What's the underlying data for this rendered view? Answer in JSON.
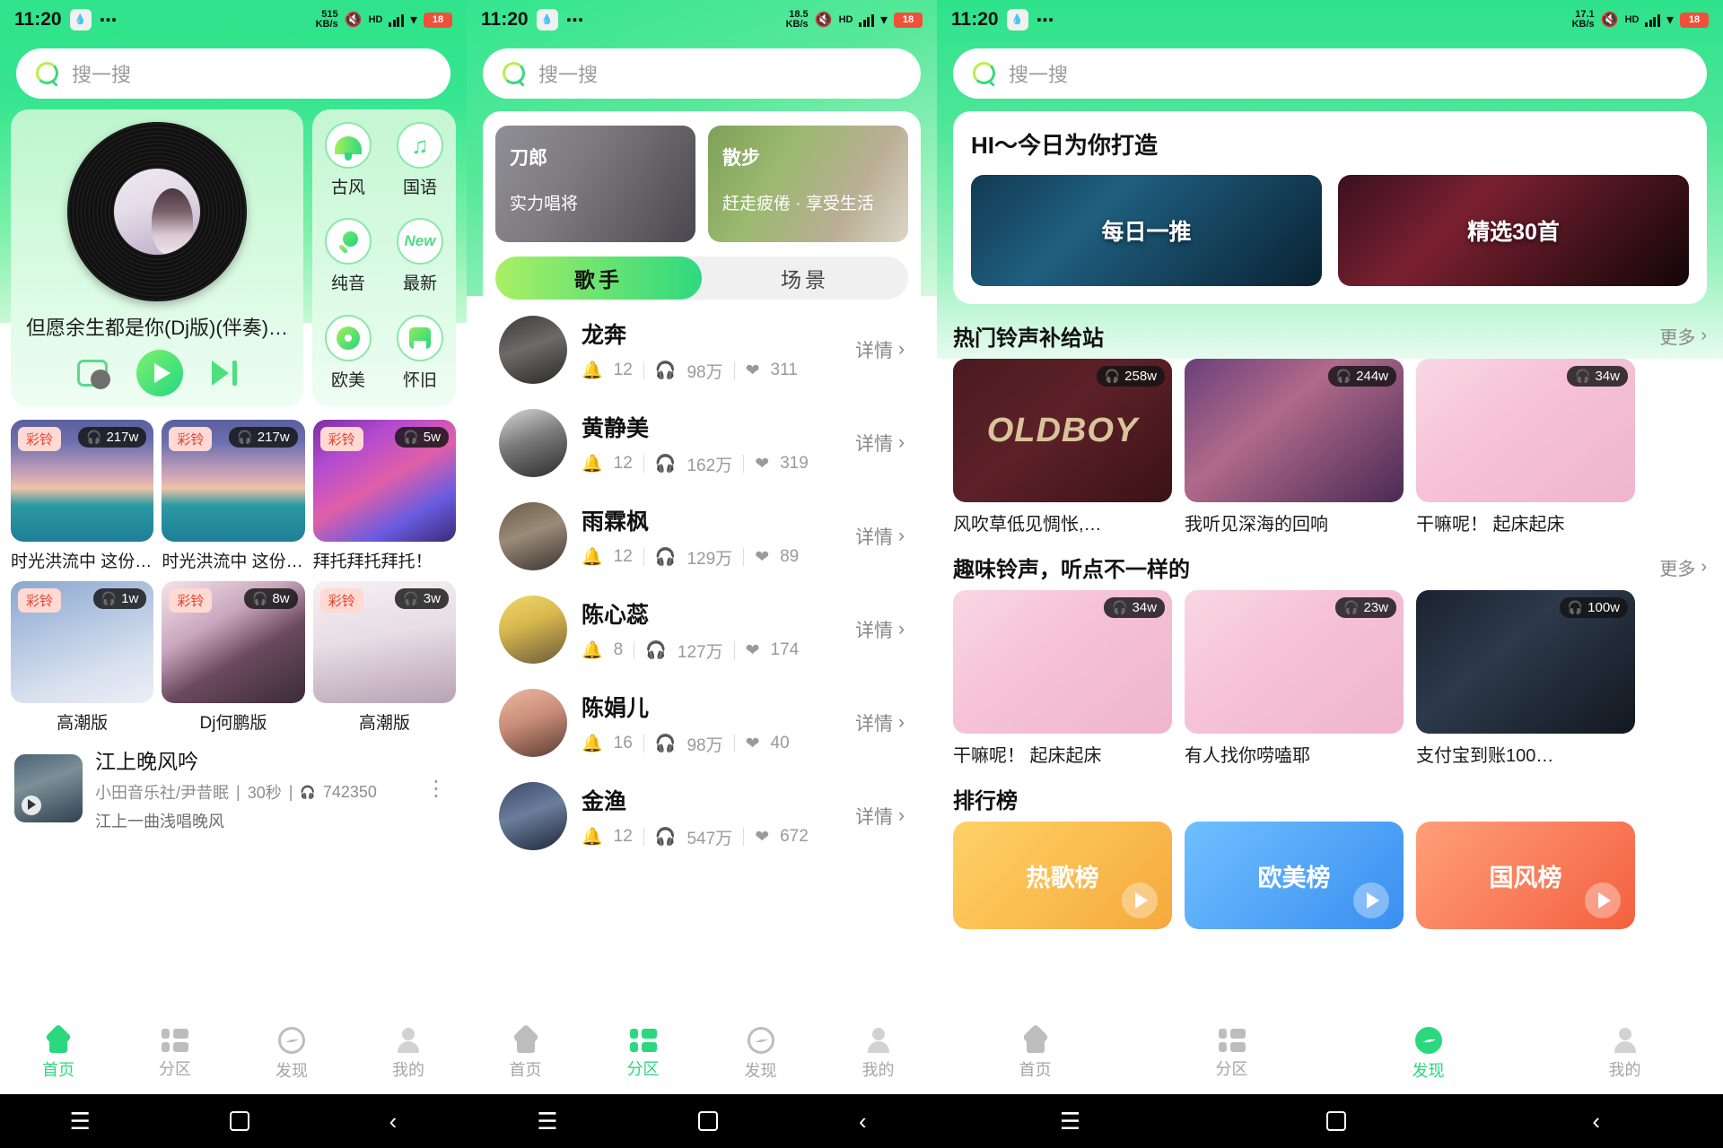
{
  "status_bar": {
    "time": "11:20",
    "badge_icon": "water-drop-icon",
    "dots": "⋯",
    "net_p1": "515\nKB/s",
    "net_p2": "18.5\nKB/s",
    "net_p3": "17.1\nKB/s",
    "hd": "HD",
    "battery": "18"
  },
  "search": {
    "placeholder": "搜一搜"
  },
  "panel1": {
    "player": {
      "song_title": "但愿余生都是你(Dj版)(伴奏)…",
      "record_label": "record-button",
      "play_label": "play-button",
      "next_label": "next-button"
    },
    "categories": [
      {
        "label": "古风",
        "icon": "fan-icon"
      },
      {
        "label": "国语",
        "icon": "music-note-icon"
      },
      {
        "label": "纯音",
        "icon": "microphone-icon"
      },
      {
        "label": "最新",
        "icon": "new-icon"
      },
      {
        "label": "欧美",
        "icon": "cd-icon"
      },
      {
        "label": "怀旧",
        "icon": "radio-icon"
      }
    ],
    "thumbs": [
      {
        "tag": "彩铃",
        "plays": "217w",
        "caption": "时光洪流中 这份…",
        "art": "art-wave",
        "center": false
      },
      {
        "tag": "彩铃",
        "plays": "217w",
        "caption": "时光洪流中 这份…",
        "art": "art-wave",
        "center": false
      },
      {
        "tag": "彩铃",
        "plays": "5w",
        "caption": "拜托拜托拜托！",
        "art": "art-anime",
        "center": false
      },
      {
        "tag": "彩铃",
        "plays": "1w",
        "caption": "高潮版",
        "art": "art-snow",
        "center": true
      },
      {
        "tag": "彩铃",
        "plays": "8w",
        "caption": "Dj何鹏版",
        "art": "art-girl",
        "center": true
      },
      {
        "tag": "彩铃",
        "plays": "3w",
        "caption": "高潮版",
        "art": "art-girl2",
        "center": true
      }
    ],
    "song": {
      "name": "江上晚风吟",
      "artist": "小田音乐社/尹昔眠",
      "duration": "30秒",
      "plays": "742350",
      "lyric": "江上一曲浅唱晚风",
      "more": "more-icon"
    },
    "tabs": [
      {
        "label": "首页",
        "icon": "home-icon",
        "active": true
      },
      {
        "label": "分区",
        "icon": "grid-icon",
        "active": false
      },
      {
        "label": "发现",
        "icon": "compass-icon",
        "active": false
      },
      {
        "label": "我的",
        "icon": "user-icon",
        "active": false
      }
    ]
  },
  "panel2": {
    "banners": [
      {
        "line1": "刀郎",
        "line2": "实力唱将",
        "theme": "bn-dl"
      },
      {
        "line1": "散步",
        "line2": "赶走疲倦 · 享受生活",
        "theme": "bn-wk"
      }
    ],
    "segments": [
      {
        "label": "歌手",
        "active": true
      },
      {
        "label": "场景",
        "active": false
      }
    ],
    "detail_label": "详情",
    "artists": [
      {
        "name": "龙奔",
        "rings": "12",
        "plays": "98万",
        "likes": "311",
        "av": "av1"
      },
      {
        "name": "黄静美",
        "rings": "12",
        "plays": "162万",
        "likes": "319",
        "av": "av2"
      },
      {
        "name": "雨霖枫",
        "rings": "12",
        "plays": "129万",
        "likes": "89",
        "av": "av3"
      },
      {
        "name": "陈心蕊",
        "rings": "8",
        "plays": "127万",
        "likes": "174",
        "av": "av4"
      },
      {
        "name": "陈娟儿",
        "rings": "16",
        "plays": "98万",
        "likes": "40",
        "av": "av5"
      },
      {
        "name": "金渔",
        "rings": "12",
        "plays": "547万",
        "likes": "672",
        "av": "av6"
      }
    ],
    "tabs": [
      {
        "label": "首页",
        "icon": "home-icon",
        "active": false
      },
      {
        "label": "分区",
        "icon": "grid-icon",
        "active": true
      },
      {
        "label": "发现",
        "icon": "compass-icon",
        "active": false
      },
      {
        "label": "我的",
        "icon": "user-icon",
        "active": false
      }
    ]
  },
  "panel3": {
    "hero": {
      "title": "HI～今日为你打造",
      "cards": [
        {
          "label": "每日一推",
          "theme": "hc1"
        },
        {
          "label": "精选30首",
          "theme": "hc2"
        }
      ]
    },
    "sections": [
      {
        "title": "热门铃声补给站",
        "more": "更多",
        "items": [
          {
            "plays": "258w",
            "caption": "风吹草低见惆怅,…",
            "art": "a-oldboy",
            "art_text": "OLDBOY"
          },
          {
            "plays": "244w",
            "caption": "我听见深海的回响",
            "art": "a-deep",
            "art_text": ""
          },
          {
            "plays": "34w",
            "caption": "干嘛呢！ 起床起床",
            "art": "a-pink",
            "art_text": ""
          }
        ]
      },
      {
        "title": "趣味铃声，听点不一样的",
        "more": "更多",
        "items": [
          {
            "plays": "34w",
            "caption": "干嘛呢！ 起床起床",
            "art": "a-pink",
            "art_text": ""
          },
          {
            "plays": "23w",
            "caption": "有人找你唠嗑耶",
            "art": "a-pink",
            "art_text": ""
          },
          {
            "plays": "100w",
            "caption": "支付宝到账100…",
            "art": "a-map",
            "art_text": ""
          }
        ]
      }
    ],
    "rank": {
      "title": "排行榜",
      "items": [
        {
          "label": "热歌榜",
          "theme": "rk1"
        },
        {
          "label": "欧美榜",
          "theme": "rk2"
        },
        {
          "label": "国风榜",
          "theme": "rk3"
        }
      ]
    },
    "tabs": [
      {
        "label": "首页",
        "icon": "home-icon",
        "active": false
      },
      {
        "label": "分区",
        "icon": "grid-icon",
        "active": false
      },
      {
        "label": "发现",
        "icon": "compass-icon",
        "active": true
      },
      {
        "label": "我的",
        "icon": "user-icon",
        "active": false
      }
    ]
  },
  "navbar": {
    "menu": "☰",
    "home": "square-icon",
    "back": "‹"
  }
}
